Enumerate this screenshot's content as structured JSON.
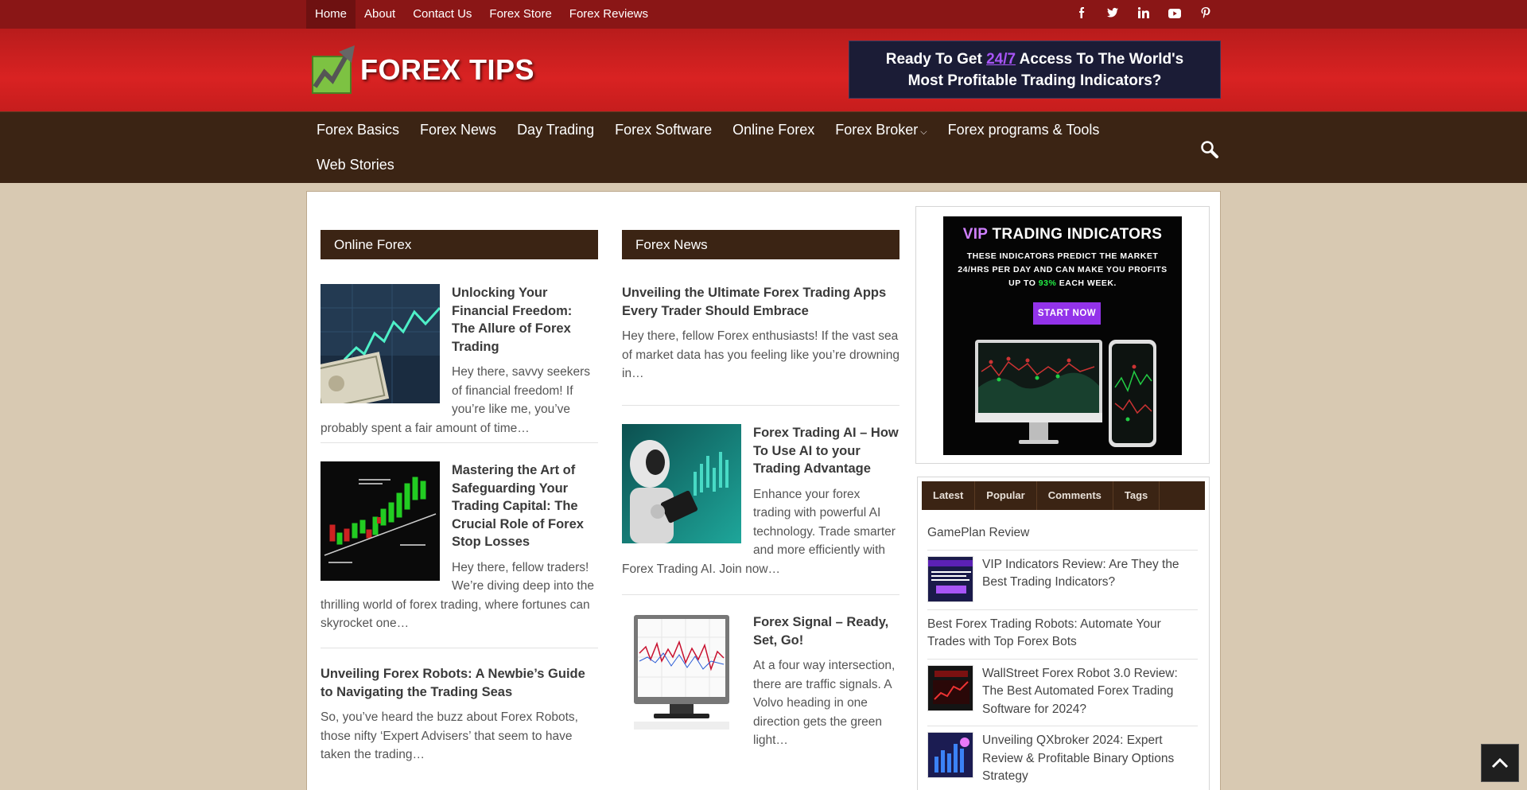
{
  "topnav": {
    "items": [
      "Home",
      "About",
      "Contact Us",
      "Forex Store",
      "Forex Reviews"
    ],
    "social": [
      "f",
      "t",
      "in",
      "yt",
      "p"
    ]
  },
  "logo": {
    "text": "FOREX TIPS"
  },
  "banner": {
    "line1_pre": "Ready To Get",
    "line1_hl": "24/7",
    "line1_post": "Access To The World's",
    "line2": "Most Profitable Trading Indicators?"
  },
  "mainnav": {
    "items": [
      "Forex Basics",
      "Forex News",
      "Day Trading",
      "Forex Software",
      "Online Forex",
      "Forex Broker",
      "Forex programs & Tools",
      "Web Stories"
    ]
  },
  "col1": {
    "title": "Online Forex",
    "posts": [
      {
        "title": "Unlocking Your Financial Freedom: The Allure of Forex Trading",
        "excerpt": "Hey there, savvy seekers of financial freedom! If you’re like me, you’ve probably spent a fair amount of time…"
      },
      {
        "title": "Mastering the Art of Safeguarding Your Trading Capital: The Crucial Role of Forex Stop Losses",
        "excerpt": "Hey there, fellow traders! We’re diving deep into the thrilling world of forex trading, where fortunes can skyrocket one…"
      },
      {
        "title": "Unveiling Forex Robots: A Newbie’s Guide to Navigating the Trading Seas",
        "excerpt": "So, you’ve heard the buzz about Forex Robots, those nifty ‘Expert Advisers’ that seem to have taken the trading…"
      }
    ]
  },
  "col2": {
    "title": "Forex News",
    "posts": [
      {
        "title": "Unveiling the Ultimate Forex Trading Apps Every Trader Should Embrace",
        "excerpt": "Hey there, fellow Forex enthusiasts! If the vast sea of market data has you feeling like you’re drowning in…"
      },
      {
        "title": "Forex Trading AI – How To Use AI to your Trading Advantage",
        "excerpt": "Enhance your forex trading with powerful AI technology. Trade smarter and more efficiently with Forex Trading AI. Join now…"
      },
      {
        "title": "Forex Signal – Ready, Set, Go!",
        "excerpt": "At a four way intersection, there are traffic signals. A Volvo heading in one direction gets the green light…"
      }
    ]
  },
  "ad": {
    "title_vip": "VIP",
    "title_rest": "TRADING INDICATORS",
    "sub_pre": "THESE INDICATORS PREDICT THE MARKET 24/HRS PER DAY AND CAN MAKE YOU PROFITS UP TO",
    "sub_pct": "93%",
    "sub_post": "EACH WEEK.",
    "button": "START NOW"
  },
  "sidebar_tabs": {
    "tabs": [
      "Latest",
      "Popular",
      "Comments",
      "Tags"
    ],
    "items": [
      {
        "text": "GamePlan Review"
      },
      {
        "text": "VIP Indicators Review: Are They the Best Trading Indicators?"
      },
      {
        "text": "Best Forex Trading Robots: Automate Your Trades with Top Forex Bots"
      },
      {
        "text": "WallStreet Forex Robot 3.0 Review: The Best Automated Forex Trading Software for 2024?"
      },
      {
        "text": "Unveiling QXbroker 2024: Expert Review & Profitable Binary Options Strategy"
      }
    ]
  },
  "colors": {
    "topbar": "#8a1616",
    "header": "#d92222",
    "nav": "#3b2414",
    "page_bg": "#d8c9b2",
    "accent_purple": "#9333ea"
  }
}
